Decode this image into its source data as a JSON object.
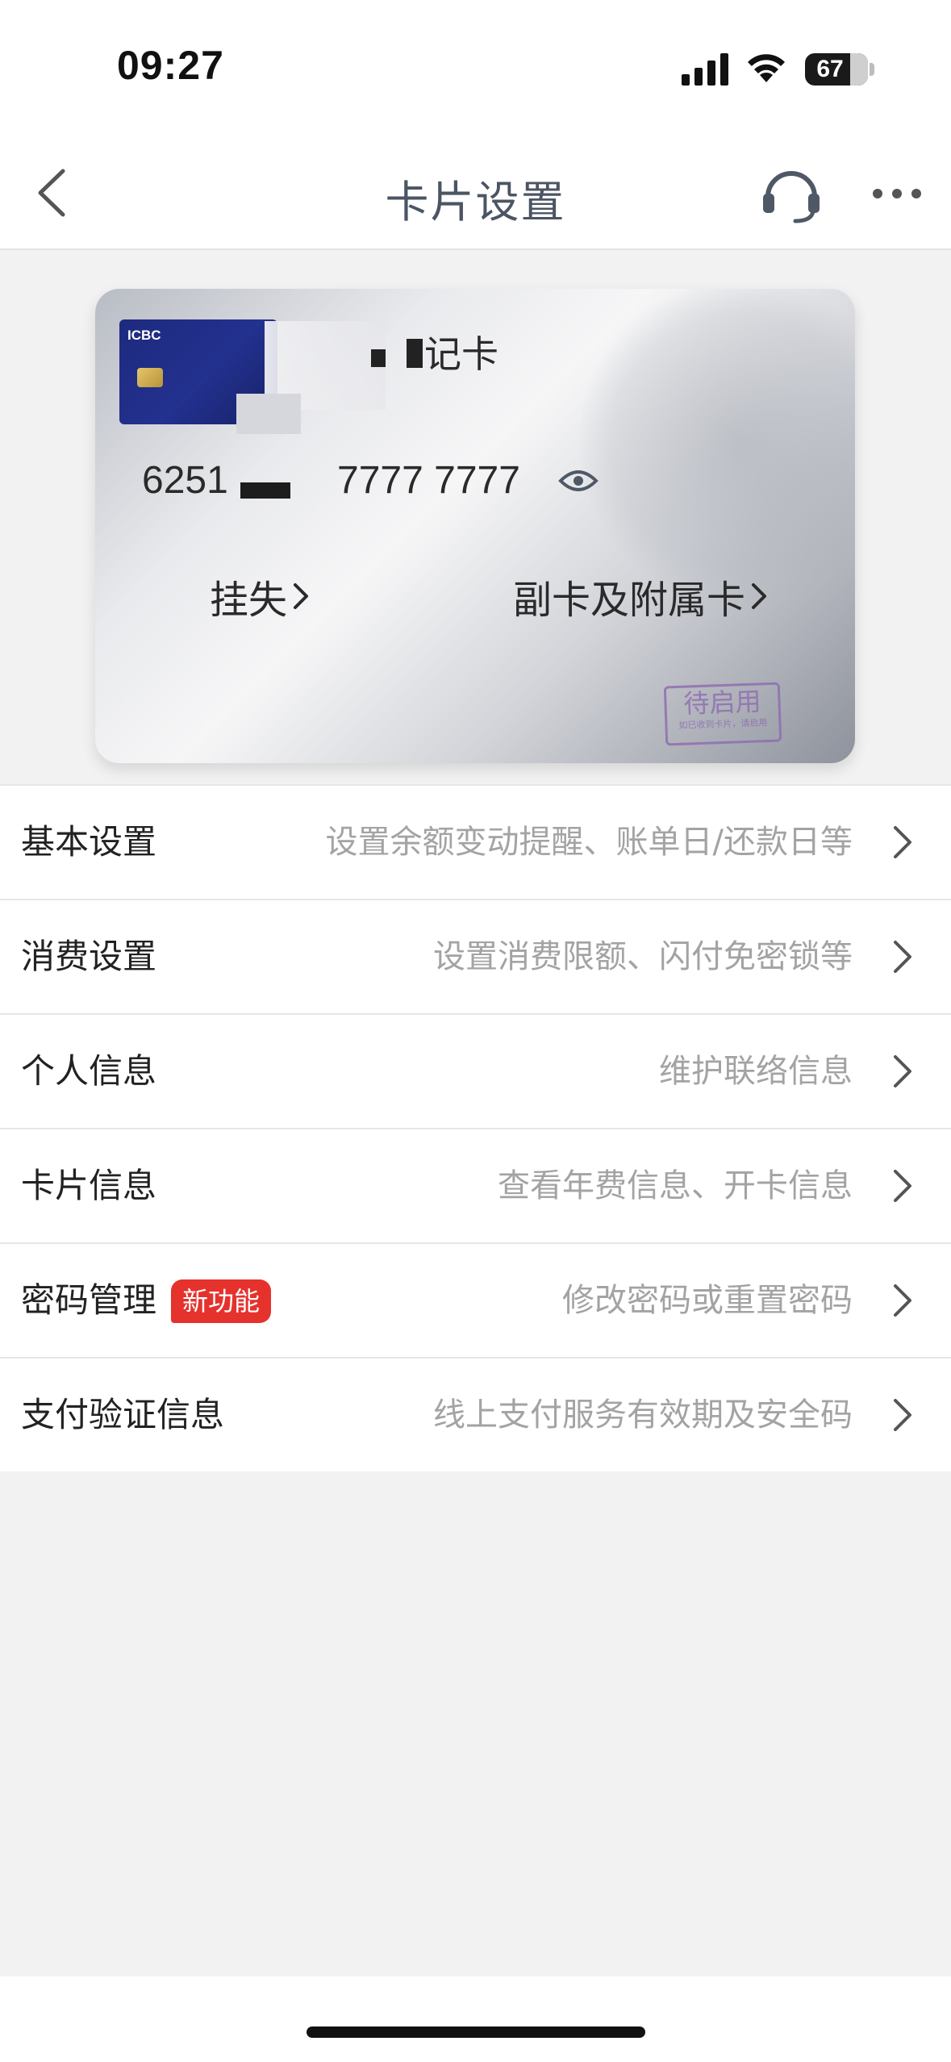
{
  "status_bar": {
    "time": "09:27",
    "battery": "67"
  },
  "nav": {
    "title": "卡片设置",
    "back_icon": "chevron-left-icon",
    "service_icon": "headset-icon",
    "more_icon": "more-dots-icon"
  },
  "card": {
    "name": "记卡",
    "number_prefix": "6251",
    "number_suffix": "7777 7777",
    "links": {
      "report_loss": "挂失",
      "sub_cards": "副卡及附属卡"
    },
    "stamp": {
      "main": "待启用",
      "sub": "如已收到卡片，请启用"
    },
    "thumb_logo": "ICBC"
  },
  "settings": [
    {
      "title": "基本设置",
      "desc": "设置余额变动提醒、账单日/还款日等"
    },
    {
      "title": "消费设置",
      "desc": "设置消费限额、闪付免密锁等"
    },
    {
      "title": "个人信息",
      "desc": "维护联络信息"
    },
    {
      "title": "卡片信息",
      "desc": "查看年费信息、开卡信息"
    },
    {
      "title": "密码管理",
      "badge": "新功能",
      "desc": "修改密码或重置密码"
    },
    {
      "title": "支付验证信息",
      "desc": "线上支付服务有效期及安全码"
    }
  ],
  "colors": {
    "badge_red": "#e5322d",
    "stamp_purple": "#8f6fb2",
    "nav_title": "#4b5563"
  }
}
